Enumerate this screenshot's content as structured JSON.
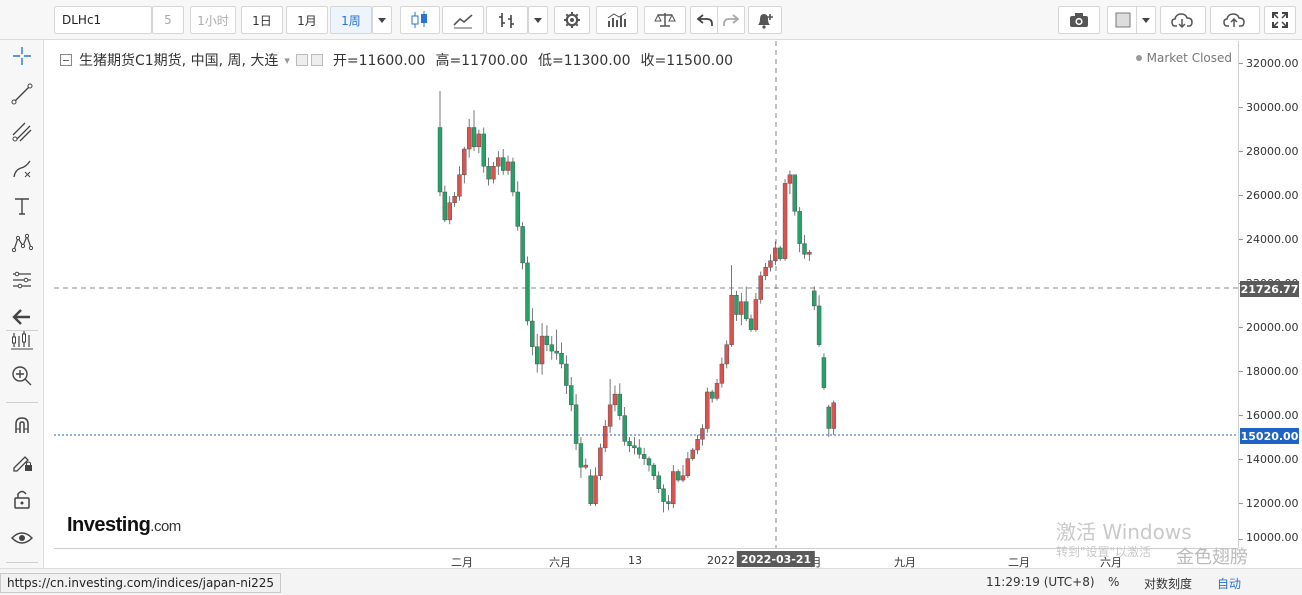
{
  "toolbar": {
    "symbol": "DLHc1",
    "intervals": [
      "5",
      "1小时",
      "1日",
      "1月",
      "1周"
    ],
    "active_interval": "1周"
  },
  "legend": {
    "title": "生猪期货C1期货, 中国, 周, 大连",
    "open": "开=11600.00",
    "high": "高=11700.00",
    "low": "低=11300.00",
    "close": "收=11500.00",
    "market_status": "Market Closed"
  },
  "y_axis": {
    "labels": [
      "32000.00",
      "30000.00",
      "28000.00",
      "26000.00",
      "24000.00",
      "22000.00",
      "20000.00",
      "18000.00",
      "16000.00",
      "14000.00",
      "12000.00",
      "10000.00"
    ],
    "crosshair_value": "21726.77",
    "last_price": "15020.00"
  },
  "x_axis": {
    "labels": [
      "二月",
      "六月",
      "13",
      "2022",
      "月",
      "九月",
      "二月",
      "六月"
    ],
    "crosshair_date": "2022-03-21"
  },
  "branding": {
    "logo_main": "Investing",
    "logo_suffix": ".com"
  },
  "windows_watermark": {
    "line1": "激活 Windows",
    "line2": "转到\"设置\"以激活",
    "line3": "金色翅膀"
  },
  "status": {
    "url": "https://cn.investing.com/indices/japan-ni225",
    "time": "11:29:19 (UTC+8)",
    "percent": "%",
    "log_scale": "对数刻度",
    "auto": "自动"
  },
  "colors": {
    "up": "#d9534f",
    "down": "#26a269",
    "last_price": "#1f63c6",
    "crosshair_badge": "#5a5a5a"
  },
  "chart_data": {
    "type": "candlestick",
    "ylim": [
      10000,
      32000
    ],
    "candles": [
      [
        29000,
        30700,
        25800,
        26000
      ],
      [
        26000,
        26300,
        24600,
        24700
      ],
      [
        24700,
        25800,
        24500,
        25500
      ],
      [
        25500,
        26000,
        25300,
        25800
      ],
      [
        25800,
        27200,
        25600,
        26800
      ],
      [
        26800,
        28100,
        26400,
        28000
      ],
      [
        28000,
        29400,
        27600,
        29000
      ],
      [
        29000,
        29800,
        27900,
        28100
      ],
      [
        28100,
        28900,
        27800,
        28700
      ],
      [
        28700,
        29000,
        26900,
        27200
      ],
      [
        27200,
        27600,
        26300,
        26600
      ],
      [
        26600,
        27400,
        26400,
        27200
      ],
      [
        27200,
        27900,
        26800,
        27600
      ],
      [
        27600,
        28000,
        26800,
        27000
      ],
      [
        27000,
        27700,
        26800,
        27400
      ],
      [
        27400,
        27600,
        25800,
        26000
      ],
      [
        26000,
        26500,
        24200,
        24400
      ],
      [
        24400,
        24600,
        22400,
        22700
      ],
      [
        22700,
        23000,
        19800,
        20000
      ],
      [
        20000,
        20600,
        18400,
        18800
      ],
      [
        18800,
        19400,
        17600,
        18000
      ],
      [
        18000,
        19900,
        17500,
        19300
      ],
      [
        19300,
        19800,
        18600,
        18900
      ],
      [
        18900,
        19300,
        18200,
        18600
      ],
      [
        18600,
        19600,
        18200,
        18500
      ],
      [
        18500,
        19000,
        17800,
        18000
      ],
      [
        18000,
        18400,
        16600,
        17000
      ],
      [
        17000,
        17400,
        15800,
        16100
      ],
      [
        16100,
        16600,
        14000,
        14300
      ],
      [
        14300,
        14600,
        12700,
        13200
      ],
      [
        13200,
        13600,
        13100,
        13300
      ],
      [
        12800,
        13100,
        11400,
        11500
      ],
      [
        11500,
        13200,
        11400,
        12800
      ],
      [
        12800,
        14300,
        12600,
        14100
      ],
      [
        14100,
        15400,
        13900,
        15100
      ],
      [
        15100,
        17300,
        14800,
        16100
      ],
      [
        16100,
        17000,
        15800,
        16600
      ],
      [
        16600,
        17100,
        15400,
        15600
      ],
      [
        15600,
        16000,
        14200,
        14400
      ],
      [
        14400,
        14600,
        13900,
        14200
      ],
      [
        14200,
        14600,
        13800,
        14100
      ],
      [
        14100,
        14500,
        13600,
        13800
      ],
      [
        13800,
        14100,
        13300,
        13600
      ],
      [
        13600,
        13700,
        13000,
        13300
      ],
      [
        13300,
        13400,
        12600,
        12800
      ],
      [
        12800,
        13000,
        12000,
        12200
      ],
      [
        12200,
        12400,
        11100,
        11600
      ],
      [
        11600,
        11900,
        11200,
        11500
      ],
      [
        11500,
        13300,
        11300,
        13000
      ],
      [
        13000,
        13100,
        12500,
        12600
      ],
      [
        12600,
        13300,
        12500,
        12800
      ],
      [
        12800,
        13900,
        12700,
        13600
      ],
      [
        13600,
        14100,
        13500,
        14000
      ],
      [
        14000,
        14700,
        13800,
        14500
      ],
      [
        14500,
        15200,
        14200,
        15000
      ],
      [
        15000,
        16900,
        14800,
        16700
      ],
      [
        16700,
        16800,
        16200,
        16400
      ],
      [
        16400,
        17300,
        16300,
        17100
      ],
      [
        17100,
        18300,
        16900,
        18000
      ],
      [
        18000,
        19100,
        17800,
        18900
      ],
      [
        18900,
        22600,
        18800,
        21200
      ],
      [
        21200,
        21400,
        20000,
        20300
      ],
      [
        20300,
        21300,
        19800,
        20900
      ],
      [
        20900,
        21600,
        20000,
        20100
      ],
      [
        20100,
        20300,
        19500,
        19600
      ],
      [
        19600,
        21300,
        19500,
        21000
      ],
      [
        21000,
        22300,
        20800,
        22100
      ],
      [
        22100,
        22700,
        21900,
        22500
      ],
      [
        22500,
        23100,
        22300,
        22800
      ],
      [
        22800,
        23700,
        22600,
        23400
      ],
      [
        23400,
        23500,
        22800,
        22900
      ],
      [
        22900,
        26600,
        22800,
        26400
      ],
      [
        26400,
        27000,
        25900,
        26800
      ],
      [
        26800,
        26800,
        24900,
        25100
      ],
      [
        25100,
        25300,
        23200,
        23600
      ],
      [
        23600,
        24000,
        22900,
        23100
      ],
      [
        23100,
        23300,
        22800,
        23200
      ],
      [
        21400,
        21600,
        20500,
        20700
      ],
      [
        20700,
        21200,
        18800,
        18900
      ],
      [
        18300,
        18500,
        16800,
        16900
      ],
      [
        16000,
        16100,
        14600,
        15000
      ],
      [
        15000,
        16300,
        14700,
        16200
      ]
    ]
  }
}
